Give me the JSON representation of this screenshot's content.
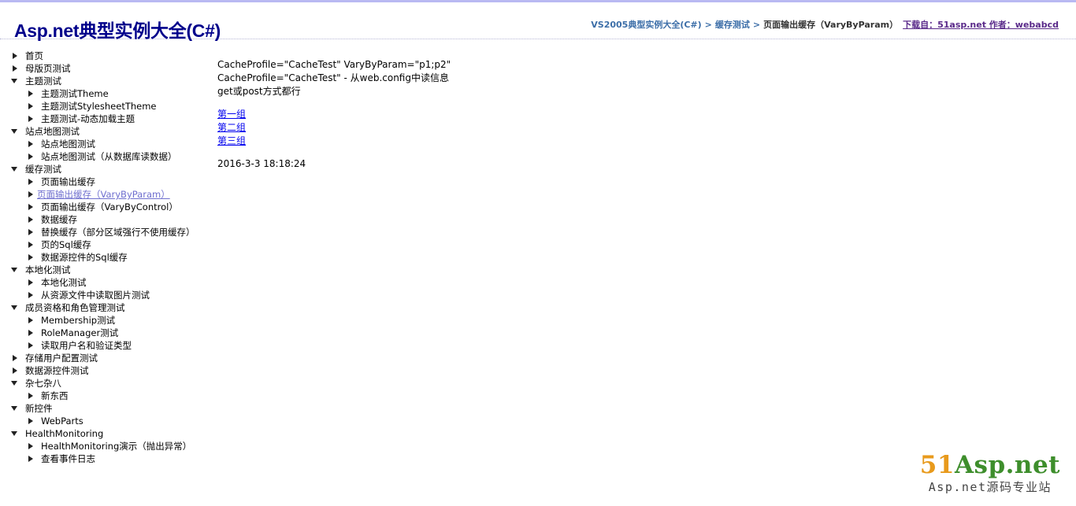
{
  "header": {
    "site_title": "Asp.net典型实例大全(C#)",
    "breadcrumb": {
      "home": "VS2005典型实例大全(C#)",
      "separator": ">",
      "section": "缓存测试",
      "current": "页面输出缓存（VaryByParam）",
      "download": "下载自：51asp.net 作者：webabcd"
    }
  },
  "tree": {
    "items": [
      {
        "label": "首页",
        "state": "collapsed",
        "level": 0
      },
      {
        "label": "母版页测试",
        "state": "collapsed",
        "level": 0
      },
      {
        "label": "主题测试",
        "state": "expanded",
        "level": 0
      },
      {
        "label": "主题测试Theme",
        "state": "collapsed",
        "level": 1
      },
      {
        "label": "主题测试StylesheetTheme",
        "state": "collapsed",
        "level": 1
      },
      {
        "label": "主题测试-动态加载主题",
        "state": "collapsed",
        "level": 1
      },
      {
        "label": "站点地图测试",
        "state": "expanded",
        "level": 0
      },
      {
        "label": "站点地图测试",
        "state": "collapsed",
        "level": 1
      },
      {
        "label": "站点地图测试（从数据库读数据）",
        "state": "collapsed",
        "level": 1
      },
      {
        "label": "缓存测试",
        "state": "expanded",
        "level": 0
      },
      {
        "label": "页面输出缓存",
        "state": "collapsed",
        "level": 1
      },
      {
        "label": "页面输出缓存（VaryByParam）",
        "state": "collapsed",
        "level": 1,
        "selected": true
      },
      {
        "label": "页面输出缓存（VaryByControl）",
        "state": "collapsed",
        "level": 1
      },
      {
        "label": "数据缓存",
        "state": "collapsed",
        "level": 1
      },
      {
        "label": "替换缓存（部分区域强行不使用缓存）",
        "state": "collapsed",
        "level": 1
      },
      {
        "label": "页的Sql缓存",
        "state": "collapsed",
        "level": 1
      },
      {
        "label": "数据源控件的Sql缓存",
        "state": "collapsed",
        "level": 1
      },
      {
        "label": "本地化测试",
        "state": "expanded",
        "level": 0
      },
      {
        "label": "本地化测试",
        "state": "collapsed",
        "level": 1
      },
      {
        "label": "从资源文件中读取图片测试",
        "state": "collapsed",
        "level": 1
      },
      {
        "label": "成员资格和角色管理测试",
        "state": "expanded",
        "level": 0
      },
      {
        "label": "Membership测试",
        "state": "collapsed",
        "level": 1
      },
      {
        "label": "RoleManager测试",
        "state": "collapsed",
        "level": 1
      },
      {
        "label": "读取用户名和验证类型",
        "state": "collapsed",
        "level": 1
      },
      {
        "label": "存储用户配置测试",
        "state": "collapsed",
        "level": 0
      },
      {
        "label": "数据源控件测试",
        "state": "collapsed",
        "level": 0
      },
      {
        "label": "杂七杂八",
        "state": "expanded",
        "level": 0
      },
      {
        "label": "新东西",
        "state": "collapsed",
        "level": 1
      },
      {
        "label": "新控件",
        "state": "expanded",
        "level": 0
      },
      {
        "label": "WebParts",
        "state": "collapsed",
        "level": 1
      },
      {
        "label": "HealthMonitoring",
        "state": "expanded",
        "level": 0
      },
      {
        "label": "HealthMonitoring演示（抛出异常）",
        "state": "collapsed",
        "level": 1
      },
      {
        "label": "查看事件日志",
        "state": "collapsed",
        "level": 1
      }
    ]
  },
  "main": {
    "lines": [
      "CacheProfile=\"CacheTest\" VaryByParam=\"p1;p2\"",
      "CacheProfile=\"CacheTest\" - 从web.config中读信息",
      "get或post方式都行"
    ],
    "links": [
      "第一组",
      "第二组",
      "第三组"
    ],
    "timestamp": "2016-3-3 18:18:24"
  },
  "logo": {
    "main_51": "51",
    "main_rest": "Asp.net",
    "sub": "Asp.net源码专业站"
  }
}
